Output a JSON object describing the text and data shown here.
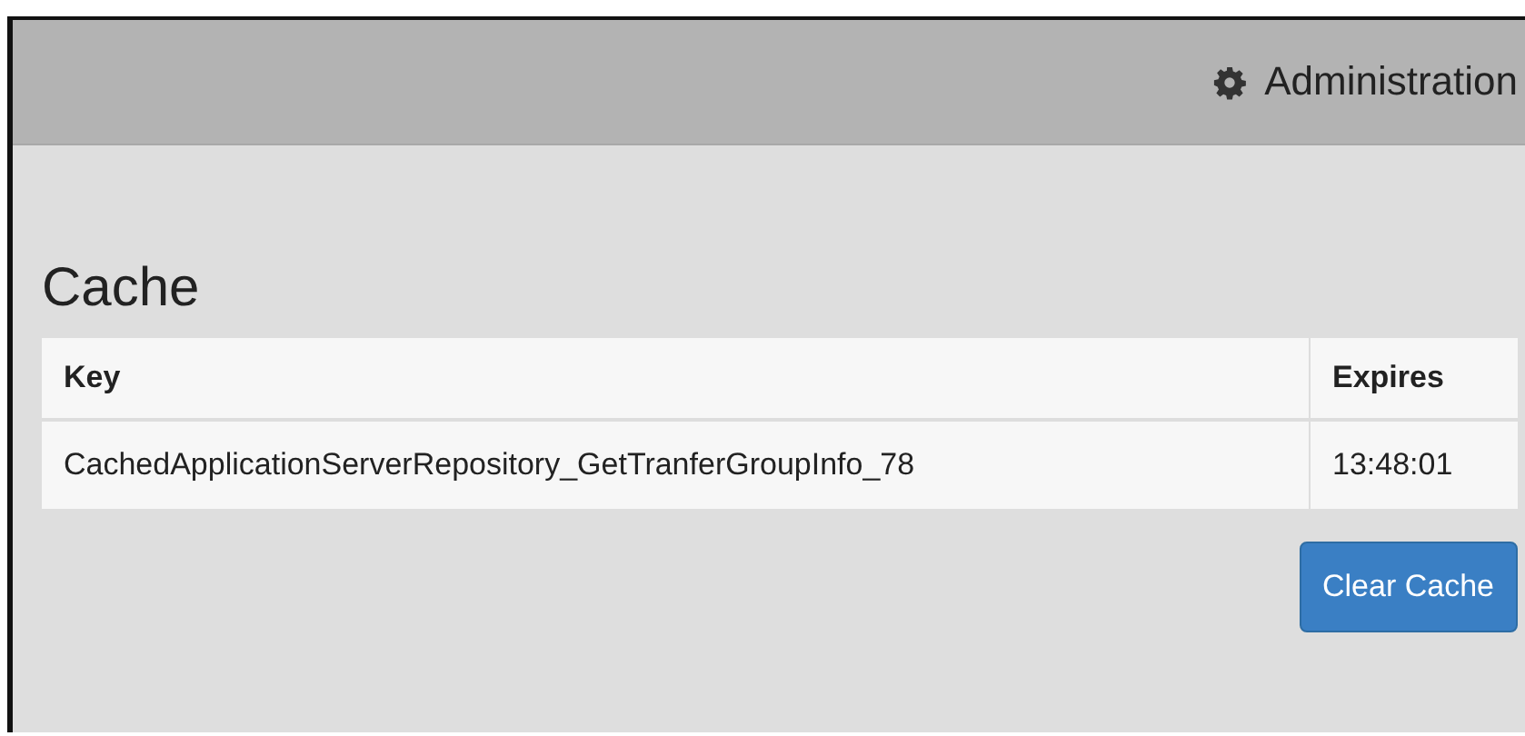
{
  "header": {
    "menu_label": "Administration"
  },
  "page": {
    "title": "Cache"
  },
  "table": {
    "columns": [
      "Key",
      "Expires"
    ],
    "rows": [
      [
        "CachedApplicationServerRepository_GetTranferGroupInfo_78",
        "13:48:01"
      ]
    ]
  },
  "buttons": [
    "Clear Cache"
  ]
}
